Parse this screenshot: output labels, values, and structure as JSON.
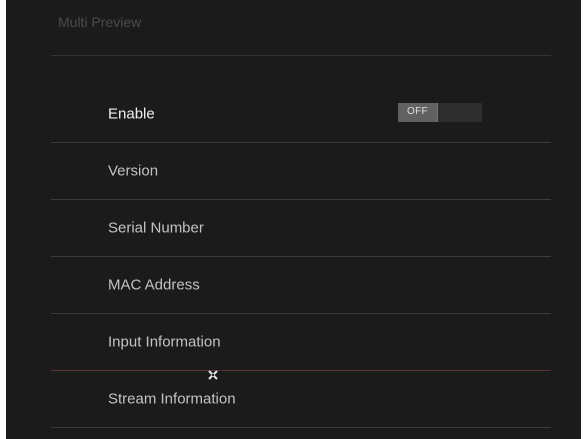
{
  "header": {
    "title": "Multi Preview"
  },
  "settings": {
    "items": [
      {
        "label": "Enable",
        "control": "toggle"
      },
      {
        "label": "Version"
      },
      {
        "label": "Serial Number"
      },
      {
        "label": "MAC Address"
      },
      {
        "label": "Input Information"
      },
      {
        "label": "Stream Information"
      }
    ],
    "enable_toggle": {
      "state_label": "OFF",
      "value": false
    }
  },
  "colors": {
    "panel_background": "#1b1b1b",
    "label_text": "#c3c3c3",
    "title_text": "#4b4b4b",
    "divider": "#3b3b3b"
  },
  "icons": {
    "cursor": "crosshair-cursor-icon"
  }
}
